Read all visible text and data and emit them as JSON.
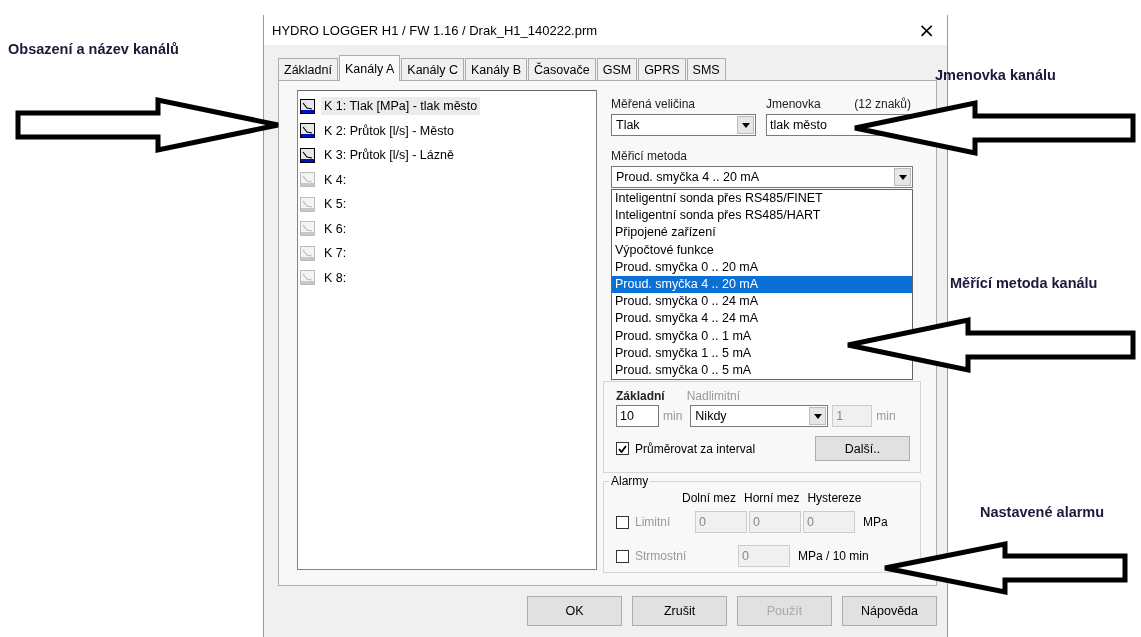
{
  "annotations": [
    {
      "text": "Obsazení a název kanálů"
    },
    {
      "text": "Jmenovka kanálu"
    },
    {
      "text": "Měřící metoda kanálu"
    },
    {
      "text": "Nastavené alarmu"
    }
  ],
  "window": {
    "title": "HYDRO LOGGER H1 / FW 1.16 / Drak_H1_140222.prm",
    "close": "×"
  },
  "tabs": [
    {
      "label": "Základní",
      "selected": false
    },
    {
      "label": "Kanály A",
      "selected": true
    },
    {
      "label": "Kanály C",
      "selected": false
    },
    {
      "label": "Kanály B",
      "selected": false
    },
    {
      "label": "Časovače",
      "selected": false
    },
    {
      "label": "GSM",
      "selected": false
    },
    {
      "label": "GPRS",
      "selected": false
    },
    {
      "label": "SMS",
      "selected": false
    }
  ],
  "channels": [
    {
      "label": "K 1: Tlak [MPa] - tlak město",
      "assigned": true,
      "selected": true
    },
    {
      "label": "K 2: Průtok [l/s] - Město",
      "assigned": true,
      "selected": false
    },
    {
      "label": "K 3: Průtok [l/s] - Lázně",
      "assigned": true,
      "selected": false
    },
    {
      "label": "K 4:",
      "assigned": false,
      "selected": false
    },
    {
      "label": "K 5:",
      "assigned": false,
      "selected": false
    },
    {
      "label": "K 6:",
      "assigned": false,
      "selected": false
    },
    {
      "label": "K 7:",
      "assigned": false,
      "selected": false
    },
    {
      "label": "K 8:",
      "assigned": false,
      "selected": false
    }
  ],
  "quantity": {
    "label": "Měřená veličina",
    "value": "Tlak"
  },
  "name_tag": {
    "label": "Jmenovka",
    "hint": "(12 znaků)",
    "value": "tlak město"
  },
  "method": {
    "label": "Měřicí metoda",
    "value": "Proud. smyčka 4 .. 20 mA",
    "options": [
      {
        "label": "Inteligentní sonda přes RS485/FINET",
        "selected": false
      },
      {
        "label": "Inteligentní sonda přes RS485/HART",
        "selected": false
      },
      {
        "label": "Připojené zařízení",
        "selected": false
      },
      {
        "label": "Výpočtové funkce",
        "selected": false
      },
      {
        "label": "Proud. smyčka 0 .. 20 mA",
        "selected": false
      },
      {
        "label": "Proud. smyčka 4 .. 20 mA",
        "selected": true
      },
      {
        "label": "Proud. smyčka 0 .. 24 mA",
        "selected": false
      },
      {
        "label": "Proud. smyčka 4 .. 24 mA",
        "selected": false
      },
      {
        "label": "Proud. smyčka 0 .. 1 mA",
        "selected": false
      },
      {
        "label": "Proud. smyčka 1 .. 5 mA",
        "selected": false
      },
      {
        "label": "Proud. smyčka 0 .. 5 mA",
        "selected": false
      }
    ]
  },
  "interval": {
    "basic_label": "Základní",
    "over_label": "Nadlimitní",
    "over_disabled": true,
    "basic_value": "10",
    "basic_unit": "min",
    "over_select": "Nikdy",
    "over_value": "1",
    "over_unit": "min",
    "average": {
      "label": "Průměrovat za interval",
      "checked": true
    },
    "more_button": "Další.."
  },
  "alarms": {
    "title": "Alarmy",
    "columns": [
      "Dolní mez",
      "Horní mez",
      "Hystereze"
    ],
    "limit": {
      "label": "Limitní",
      "checked": false,
      "disabled": true,
      "values": [
        "0",
        "0",
        "0"
      ],
      "unit": "MPa"
    },
    "slope": {
      "label": "Strmostní",
      "checked": false,
      "disabled": true,
      "value": "0",
      "unit": "MPa / 10 min"
    }
  },
  "buttons": [
    {
      "label": "OK",
      "disabled": false
    },
    {
      "label": "Zrušit",
      "disabled": false
    },
    {
      "label": "Použít",
      "disabled": true
    },
    {
      "label": "Nápověda",
      "disabled": false
    }
  ]
}
